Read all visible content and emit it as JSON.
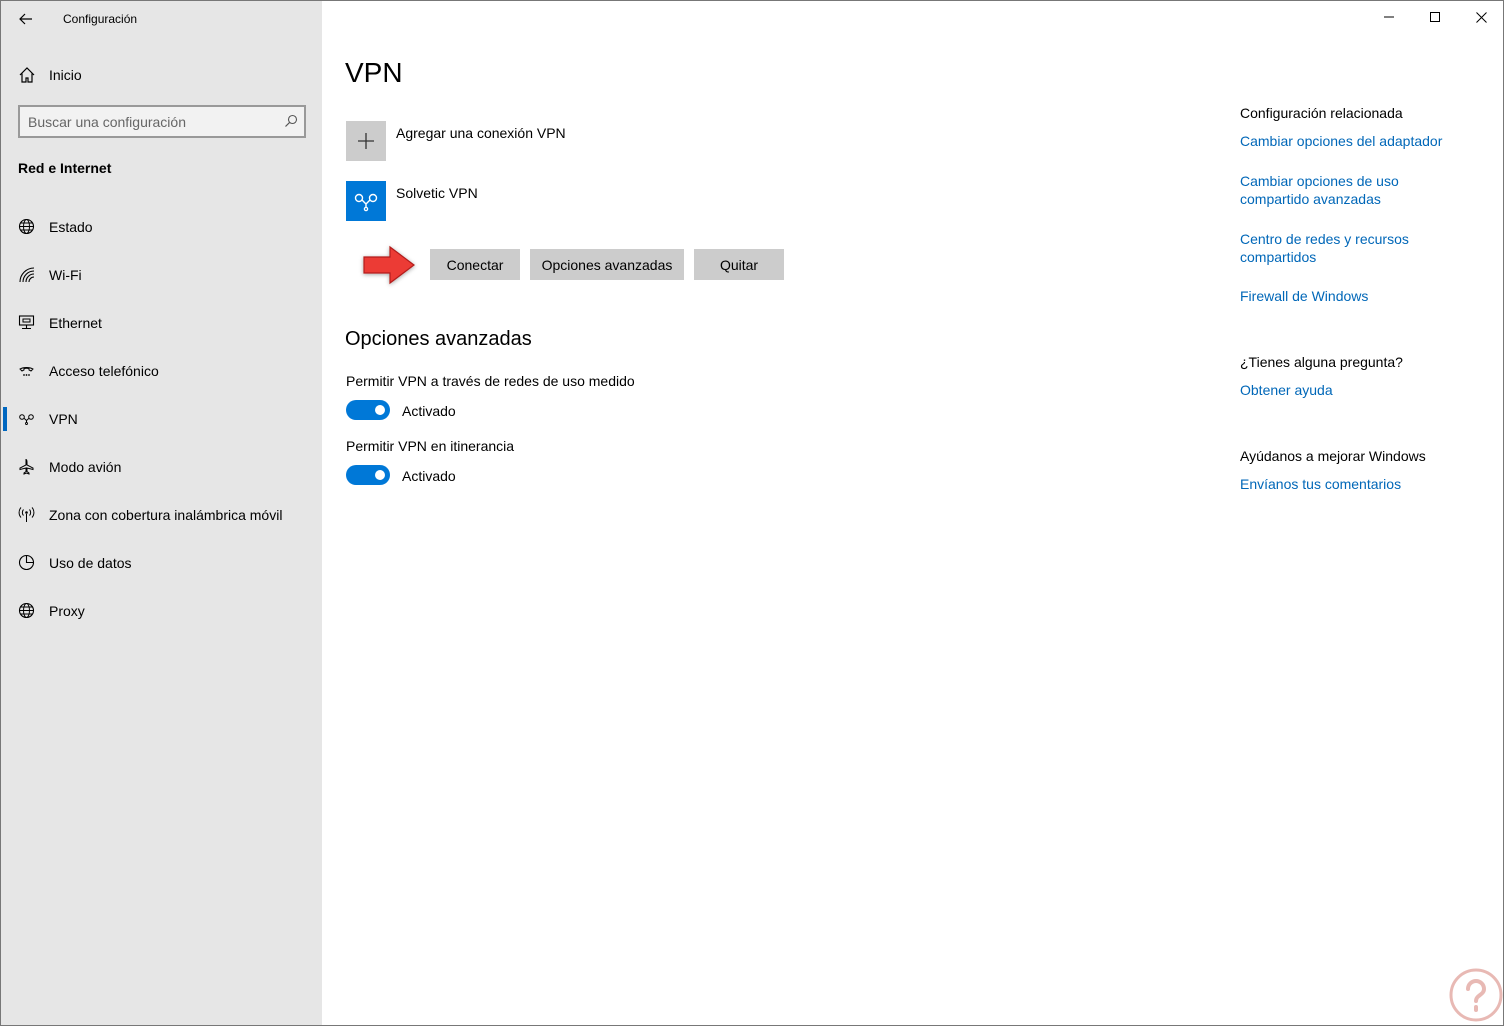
{
  "window": {
    "title": "Configuración"
  },
  "sidebar": {
    "home_label": "Inicio",
    "search_placeholder": "Buscar una configuración",
    "section_title": "Red e Internet",
    "items": [
      {
        "label": "Estado",
        "icon": "globe-status-icon"
      },
      {
        "label": "Wi-Fi",
        "icon": "wifi-icon"
      },
      {
        "label": "Ethernet",
        "icon": "ethernet-icon"
      },
      {
        "label": "Acceso telefónico",
        "icon": "dialup-icon"
      },
      {
        "label": "VPN",
        "icon": "vpn-icon"
      },
      {
        "label": "Modo avión",
        "icon": "airplane-icon"
      },
      {
        "label": "Zona con cobertura inalámbrica móvil",
        "icon": "hotspot-icon"
      },
      {
        "label": "Uso de datos",
        "icon": "data-usage-icon"
      },
      {
        "label": "Proxy",
        "icon": "globe-icon"
      }
    ],
    "active_item": "VPN"
  },
  "main": {
    "title": "VPN",
    "add_vpn_label": "Agregar una conexión VPN",
    "connection_name": "Solvetic VPN",
    "buttons": {
      "connect": "Conectar",
      "advanced": "Opciones avanzadas",
      "remove": "Quitar"
    },
    "advanced_title": "Opciones avanzadas",
    "options": [
      {
        "label": "Permitir VPN a través de redes de uso medido",
        "state": "Activado",
        "on": true
      },
      {
        "label": "Permitir VPN en itinerancia",
        "state": "Activado",
        "on": true
      }
    ]
  },
  "related": {
    "heading": "Configuración relacionada",
    "links": [
      "Cambiar opciones del adaptador",
      "Cambiar opciones de uso compartido avanzadas",
      "Centro de redes y recursos compartidos",
      "Firewall de Windows"
    ],
    "question_heading": "¿Tienes alguna pregunta?",
    "help_link": "Obtener ayuda",
    "feedback_heading": "Ayúdanos a mejorar Windows",
    "feedback_link": "Envíanos tus comentarios"
  },
  "colors": {
    "accent": "#0078d7",
    "link": "#0067b8",
    "sidebar_bg": "#e6e6e6",
    "button_bg": "#cccccc",
    "arrow": "#e8312f"
  }
}
